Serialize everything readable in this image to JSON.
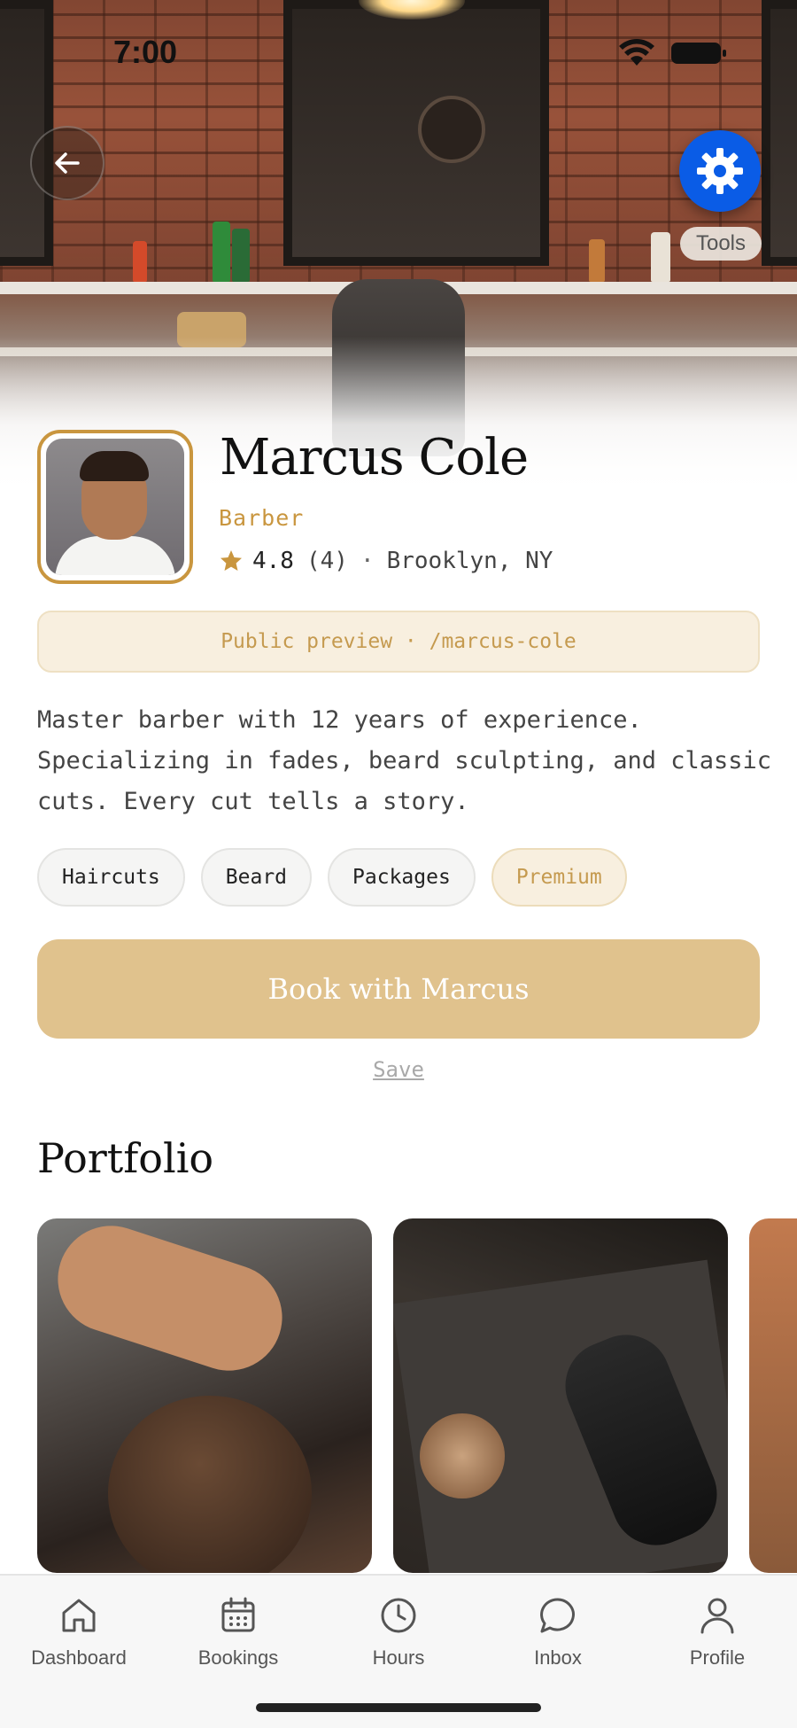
{
  "status_bar": {
    "time": "7:00"
  },
  "header": {
    "tools_label": "Tools"
  },
  "profile": {
    "name": "Marcus Cole",
    "role": "Barber",
    "rating": "4.8",
    "review_count": "(4)",
    "separator": "·",
    "location": "Brooklyn, NY"
  },
  "preview_banner": {
    "text": "Public preview · /marcus-cole"
  },
  "bio": {
    "text": "Master barber with 12 years of experience. Specializing in fades, beard sculpting, and classic cuts. Every cut tells a story."
  },
  "tags": [
    {
      "label": "Haircuts"
    },
    {
      "label": "Beard"
    },
    {
      "label": "Packages"
    },
    {
      "label": "Premium"
    }
  ],
  "actions": {
    "book_label": "Book with Marcus",
    "save_label": "Save"
  },
  "portfolio": {
    "title": "Portfolio"
  },
  "tabbar": {
    "items": [
      {
        "label": "Dashboard",
        "icon": "home-icon"
      },
      {
        "label": "Bookings",
        "icon": "calendar-icon"
      },
      {
        "label": "Hours",
        "icon": "clock-icon"
      },
      {
        "label": "Inbox",
        "icon": "chat-icon"
      },
      {
        "label": "Profile",
        "icon": "person-icon"
      }
    ]
  },
  "colors": {
    "accent": "#c9963f",
    "book_button": "#e0c28d",
    "tools_button": "#0a5ce6"
  }
}
